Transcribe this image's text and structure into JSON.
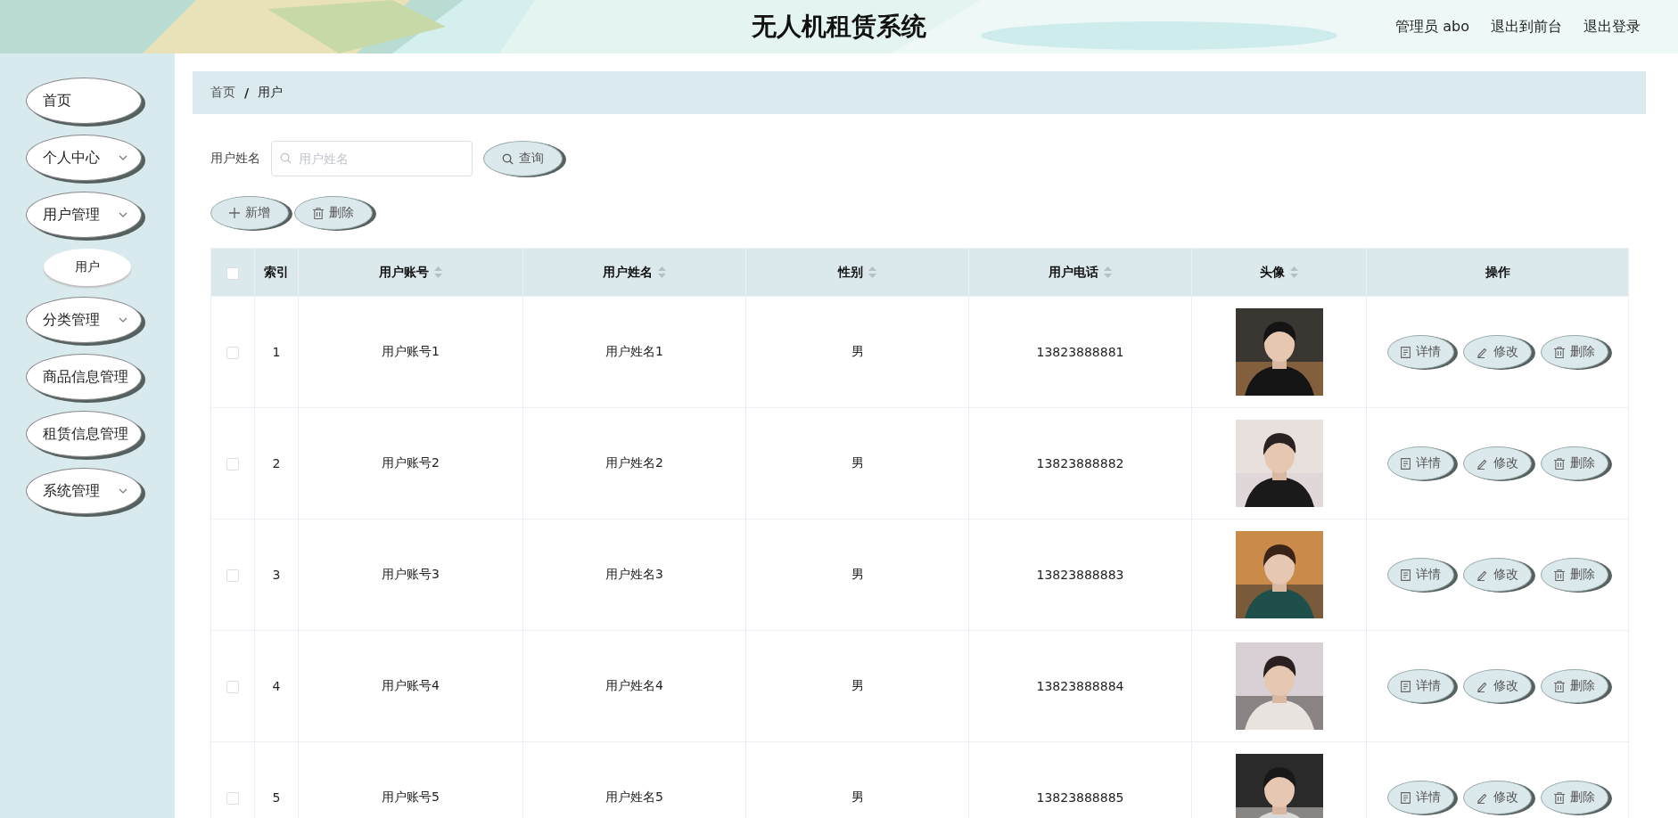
{
  "header": {
    "title": "无人机租赁系统",
    "user": "管理员 abo",
    "links": [
      "退出到前台",
      "退出登录"
    ]
  },
  "sidebar": {
    "items": [
      {
        "label": "首页",
        "expandable": false
      },
      {
        "label": "个人中心",
        "expandable": true
      },
      {
        "label": "用户管理",
        "expandable": true,
        "children": [
          {
            "label": "用户"
          }
        ]
      },
      {
        "label": "分类管理",
        "expandable": true
      },
      {
        "label": "商品信息管理",
        "expandable": false
      },
      {
        "label": "租赁信息管理",
        "expandable": false
      },
      {
        "label": "系统管理",
        "expandable": true
      }
    ]
  },
  "breadcrumb": {
    "items": [
      "首页",
      "用户"
    ],
    "separator": "/"
  },
  "search": {
    "label": "用户姓名",
    "placeholder": "用户姓名",
    "button": "查询"
  },
  "actions": [
    "新增",
    "删除"
  ],
  "table": {
    "all_checked": false,
    "columns": [
      {
        "label": "索引",
        "sortable": false
      },
      {
        "label": "用户账号",
        "sortable": true
      },
      {
        "label": "用户姓名",
        "sortable": true
      },
      {
        "label": "性别",
        "sortable": true
      },
      {
        "label": "用户电话",
        "sortable": true
      },
      {
        "label": "头像",
        "sortable": true
      },
      {
        "label": "操作",
        "sortable": false
      }
    ],
    "rows": [
      {
        "checked": false,
        "index": "1",
        "account": "用户账号1",
        "name": "用户姓名1",
        "gender": "男",
        "phone": "13823888881",
        "actions": [
          "详情",
          "修改",
          "删除"
        ]
      },
      {
        "checked": false,
        "index": "2",
        "account": "用户账号2",
        "name": "用户姓名2",
        "gender": "男",
        "phone": "13823888882",
        "actions": [
          "详情",
          "修改",
          "删除"
        ]
      },
      {
        "checked": false,
        "index": "3",
        "account": "用户账号3",
        "name": "用户姓名3",
        "gender": "男",
        "phone": "13823888883",
        "actions": [
          "详情",
          "修改",
          "删除"
        ]
      },
      {
        "checked": false,
        "index": "4",
        "account": "用户账号4",
        "name": "用户姓名4",
        "gender": "男",
        "phone": "13823888884",
        "actions": [
          "详情",
          "修改",
          "删除"
        ]
      },
      {
        "checked": false,
        "index": "5",
        "account": "用户账号5",
        "name": "用户姓名5",
        "gender": "男",
        "phone": "13823888885",
        "actions": [
          "详情",
          "修改",
          "删除"
        ]
      }
    ]
  }
}
